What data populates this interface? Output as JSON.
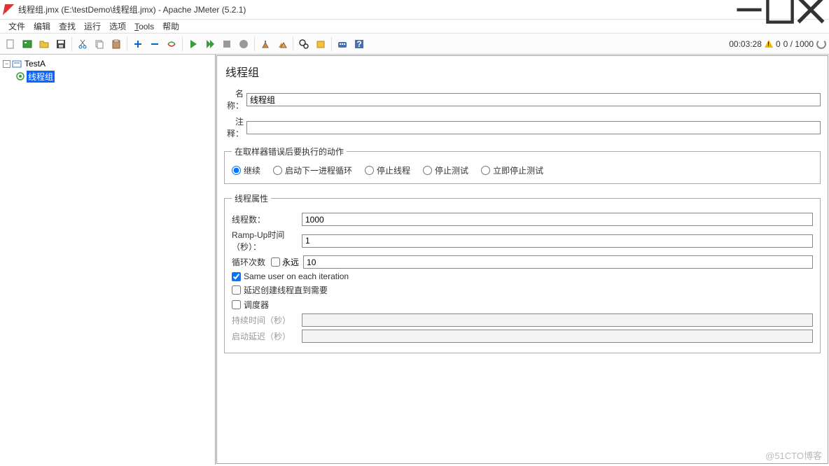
{
  "window": {
    "title": "线程组.jmx (E:\\testDemo\\线程组.jmx) - Apache JMeter (5.2.1)"
  },
  "menu": [
    "文件",
    "编辑",
    "查找",
    "运行",
    "选项",
    "Tools",
    "帮助"
  ],
  "status": {
    "time": "00:03:28",
    "counter": "0 / 1000",
    "leading_zero": "0"
  },
  "tree": {
    "root": "TestA",
    "child": "线程组"
  },
  "panel": {
    "heading": "线程组",
    "name_label": "名称：",
    "name_value": "线程组",
    "comment_label": "注释：",
    "comment_value": "",
    "error_legend": "在取样器错误后要执行的动作",
    "radios": {
      "continue": "继续",
      "next_loop": "启动下一进程循环",
      "stop_thread": "停止线程",
      "stop_test": "停止测试",
      "stop_now": "立即停止测试"
    },
    "props_legend": "线程属性",
    "threads_label": "线程数：",
    "threads_value": "1000",
    "ramp_label": "Ramp-Up时间（秒）：",
    "ramp_value": "1",
    "loop_label": "循环次数",
    "forever_label": "永远",
    "loop_value": "10",
    "same_user": "Same user on each iteration",
    "delay_create": "延迟创建线程直到需要",
    "scheduler": "调度器",
    "duration_label": "持续时间（秒）",
    "startup_label": "启动延迟（秒）"
  },
  "watermark": "@51CTO博客"
}
